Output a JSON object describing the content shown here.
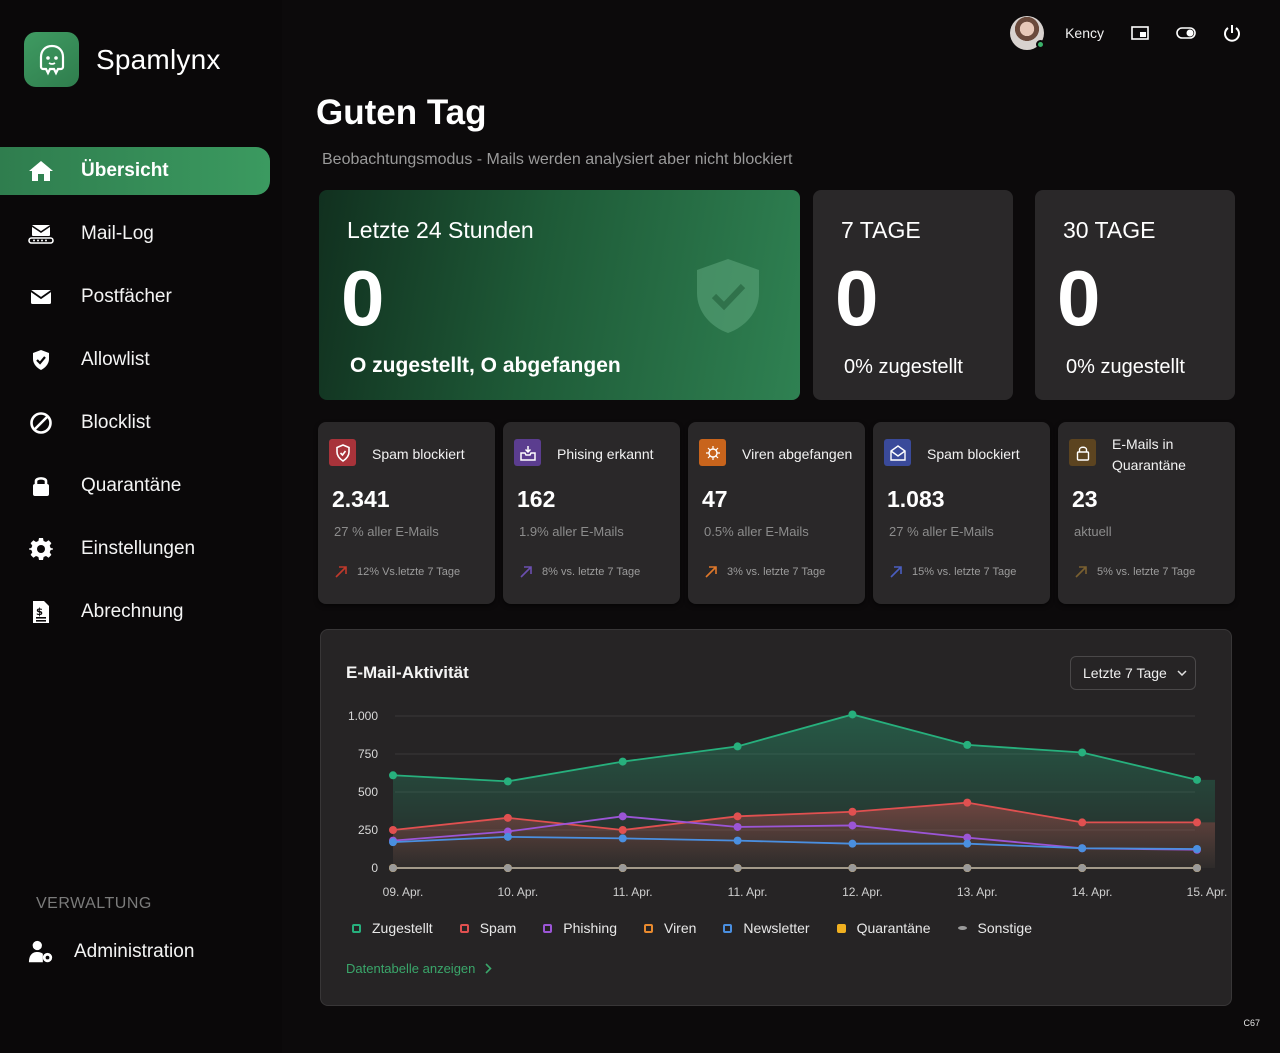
{
  "brand": {
    "name": "Spamlynx"
  },
  "sidebar": {
    "items": [
      {
        "label": "Übersicht",
        "icon": "home-icon",
        "active": true
      },
      {
        "label": "Mail-Log",
        "icon": "mail-log-icon"
      },
      {
        "label": "Postfächer",
        "icon": "envelope-icon"
      },
      {
        "label": "Allowlist",
        "icon": "shield-check-icon"
      },
      {
        "label": "Blocklist",
        "icon": "block-icon"
      },
      {
        "label": "Quarantäne",
        "icon": "lock-icon"
      },
      {
        "label": "Einstellungen",
        "icon": "gear-icon"
      },
      {
        "label": "Abrechnung",
        "icon": "invoice-icon"
      }
    ],
    "section_label": "VERWALTUNG",
    "admin": {
      "label": "Administration",
      "icon": "user-gear-icon"
    }
  },
  "topbar": {
    "user_name": "Kency"
  },
  "header": {
    "greeting": "Guten Tag",
    "subtitle": "Beobachtungsmodus - Mails werden analysiert aber nicht blockiert"
  },
  "summary": {
    "main": {
      "title": "Letzte 24 Stunden",
      "value": "0",
      "sub": "O zugestellt, O abgefangen"
    },
    "week": {
      "title": "7 TAGE",
      "value": "0",
      "sub": "0% zugestellt"
    },
    "month": {
      "title": "30 TAGE",
      "value": "0",
      "sub": "0% zugestellt"
    }
  },
  "stats": [
    {
      "label": "Spam blockiert",
      "value": "2.341",
      "pct": "27 % aller E-Mails",
      "trend": "12% Vs.letzte 7 Tage",
      "color": "#d64a4a",
      "icon": "shield-alert-icon"
    },
    {
      "label": "Phising erkannt",
      "value": "162",
      "pct": "1.9% aller E-Mails",
      "trend": "8% vs. letzte 7 Tage",
      "color": "#7b5cc4",
      "icon": "inbox-download-icon"
    },
    {
      "label": "Viren abgefangen",
      "value": "47",
      "pct": "0.5% aller E-Mails",
      "trend": "3% vs. letzte 7 Tage",
      "color": "#e0782a",
      "icon": "virus-icon"
    },
    {
      "label": "Spam blockiert",
      "value": "1.083",
      "pct": "27 % aller E-Mails",
      "trend": "15% vs. letzte 7 Tage",
      "color": "#5a6fd6",
      "icon": "mail-open-icon"
    },
    {
      "label": "E-Mails in Quarantäne",
      "value": "23",
      "pct": "aktuell",
      "trend": "5% vs. letzte 7 Tage",
      "color": "#8b6a2a",
      "icon": "padlock-icon"
    }
  ],
  "activity": {
    "title": "E-Mail-Aktivität",
    "range": "Letzte 7 Tage",
    "link": "Datentabelle anzeigen"
  },
  "chart_data": {
    "type": "line",
    "x": [
      "09. Apr.",
      "10. Apr.",
      "11. Apr.",
      "11. Apr.",
      "12. Apr.",
      "13. Apr.",
      "14. Apr.",
      "15. Apr."
    ],
    "ylim": [
      0,
      1000
    ],
    "yticks": [
      "0",
      "250",
      "500",
      "750",
      "1.000"
    ],
    "grid": true,
    "legend_position": "bottom",
    "series": [
      {
        "name": "Zugestellt",
        "color": "#27b07d",
        "values": [
          610,
          570,
          700,
          800,
          1010,
          810,
          760,
          580
        ],
        "area": true
      },
      {
        "name": "Spam",
        "color": "#e05050",
        "values": [
          250,
          330,
          250,
          340,
          370,
          430,
          300,
          300
        ],
        "area": true
      },
      {
        "name": "Phishing",
        "color": "#9b55d6",
        "values": [
          180,
          240,
          340,
          270,
          280,
          200,
          130,
          120
        ]
      },
      {
        "name": "Viren",
        "color": "#e98a2e",
        "values": [
          0,
          0,
          0,
          0,
          0,
          0,
          0,
          0
        ]
      },
      {
        "name": "Newsletter",
        "color": "#4a8fe0",
        "values": [
          170,
          205,
          195,
          180,
          160,
          160,
          130,
          125
        ]
      },
      {
        "name": "Quarantäne",
        "color": "#f0b020",
        "values": [
          0,
          0,
          0,
          0,
          0,
          0,
          0,
          0
        ]
      },
      {
        "name": "Sonstige",
        "color": "#9a9a9a",
        "values": [
          0,
          0,
          0,
          0,
          0,
          0,
          0,
          0
        ]
      }
    ]
  },
  "footer": {
    "code": "C67"
  }
}
